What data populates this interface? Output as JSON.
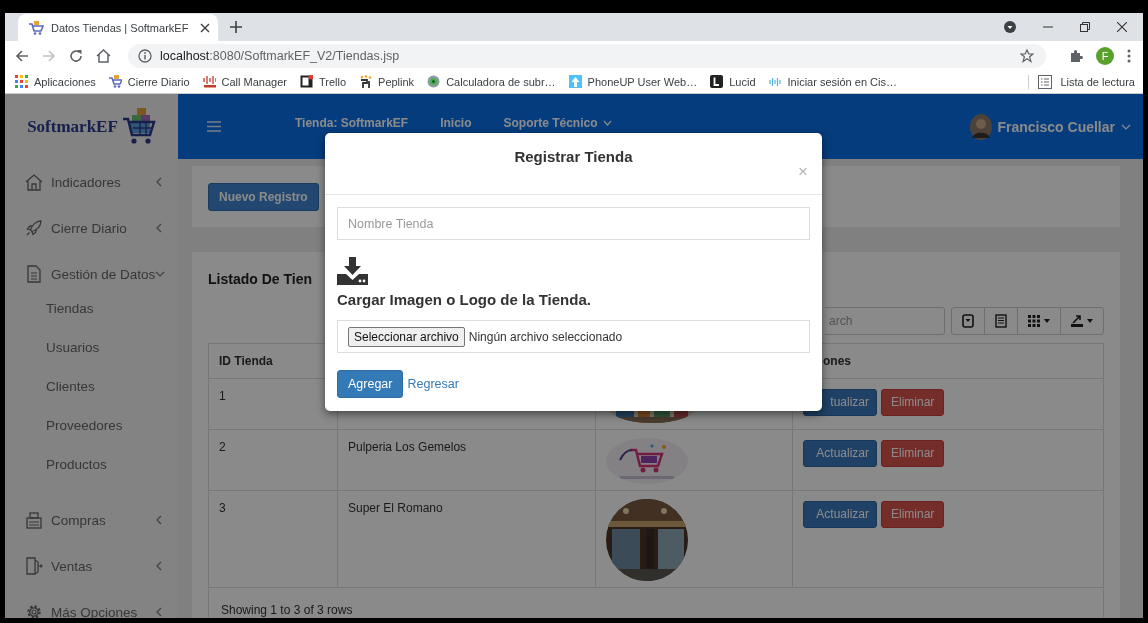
{
  "browser": {
    "tab_title": "Datos Tiendas | SoftmarkEF",
    "url_host": "localhost",
    "url_path": ":8080/SoftmarkEF_V2/Tiendas.jsp",
    "profile_initial": "F",
    "bookmarks": [
      "Aplicaciones",
      "Cierre Diario",
      "Call Manager",
      "Trello",
      "Peplink",
      "Calculadora de subr…",
      "PhoneUP User Web…",
      "Lucid",
      "Iniciar sesión en Cis…"
    ],
    "reading_list": "Lista de lectura"
  },
  "sidebar": {
    "brand": "SoftmarkEF",
    "items": [
      {
        "label": "Indicadores",
        "expanded": false
      },
      {
        "label": "Cierre Diario",
        "expanded": false
      },
      {
        "label": "Gestión de Datos",
        "expanded": true,
        "children": [
          {
            "label": "Tiendas"
          },
          {
            "label": "Usuarios"
          },
          {
            "label": "Clientes"
          },
          {
            "label": "Proveedores"
          },
          {
            "label": "Productos"
          }
        ]
      },
      {
        "label": "Compras",
        "expanded": false
      },
      {
        "label": "Ventas",
        "expanded": false
      },
      {
        "label": "Más Opciones",
        "expanded": false
      }
    ]
  },
  "header": {
    "nav": [
      {
        "label": "Tienda: SoftmarkEF",
        "dropdown": false
      },
      {
        "label": "Inicio",
        "dropdown": false
      },
      {
        "label": "Soporte Técnico",
        "dropdown": true
      }
    ],
    "user": "Francisco Cuellar"
  },
  "action_card": {
    "button": "Nuevo Registro"
  },
  "list_card": {
    "title": "Listado De Tien",
    "search": {
      "placeholder": "arch"
    },
    "table": {
      "columns": [
        {
          "label": "ID Tienda",
          "kind": "id"
        },
        {
          "label": "ones",
          "kind": "actions"
        }
      ],
      "rows": [
        {
          "id": "1",
          "image": {
            "kind": "picture"
          },
          "actions": [
            {
              "label": "tualizar",
              "kind": "update"
            },
            {
              "label": "Eliminar",
              "kind": "delete"
            }
          ]
        },
        {
          "id": "2",
          "name": "Pulperia Los Gemelos",
          "image": {
            "kind": "picture"
          },
          "actions": [
            {
              "label": "Actualizar",
              "kind": "update"
            },
            {
              "label": "Eliminar",
              "kind": "delete"
            }
          ]
        },
        {
          "id": "3",
          "name": "Super El Romano",
          "image": {
            "kind": "picture"
          },
          "actions": [
            {
              "label": "Actualizar",
              "kind": "update"
            },
            {
              "label": "Eliminar",
              "kind": "delete"
            }
          ]
        }
      ],
      "footer": "Showing 1 to 3 of 3 rows"
    }
  },
  "modal": {
    "title": "Registrar Tienda",
    "close": "×",
    "name_field": {
      "placeholder": "Nombre Tienda"
    },
    "upload_label": "Cargar Imagen o Logo de la Tienda.",
    "file_input": {
      "button": "Seleccionar archivo",
      "status": "Ningún archivo seleccionado"
    },
    "buttons": [
      {
        "label": "Agregar",
        "kind": "primary"
      },
      {
        "label": "Regresar",
        "kind": "link"
      }
    ]
  }
}
